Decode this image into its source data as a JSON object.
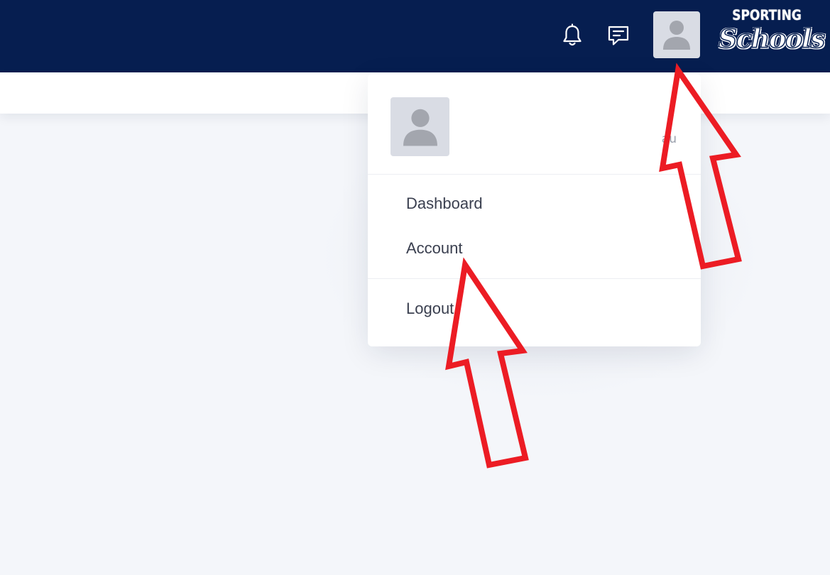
{
  "header": {
    "bell_icon": "bell-icon",
    "chat_icon": "message-icon",
    "avatar_icon": "user-avatar-icon",
    "logo": {
      "top_text": "SPORTING",
      "main_text": "Schools"
    }
  },
  "dropdown": {
    "user_name": "",
    "user_email": "au",
    "items": [
      {
        "label": "Dashboard"
      },
      {
        "label": "Account"
      }
    ],
    "logout_label": "Logout"
  },
  "annotations": {
    "arrow_color": "#ec1c24",
    "arrows": [
      "arrow-to-avatar",
      "arrow-to-account"
    ]
  },
  "colors": {
    "navbar": "#061e50",
    "background": "#f4f6fa",
    "avatar_bg": "#d9dce4",
    "avatar_fg": "#a3a6ae"
  }
}
